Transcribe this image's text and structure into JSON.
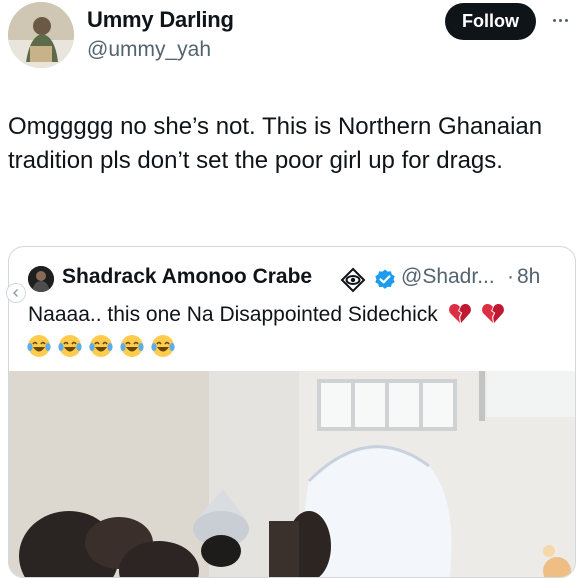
{
  "author": {
    "name": "Ummy Darling",
    "handle": "@ummy_yah",
    "follow_label": "Follow",
    "more_icon": "more-horizontal-icon"
  },
  "tweet": {
    "text": "Omggggg no she’s not. This is Northern Ghanaian tradition pls don’t set the poor girl up for drags."
  },
  "quote": {
    "author_name": "Shadrack Amonoo Crabe",
    "handle": "@Shadr...",
    "separator": "·",
    "time": "8h",
    "text": "Naaaa.. this one Na Disappointed Sidechick",
    "trailing_emoji": [
      "broken-heart",
      "broken-heart"
    ],
    "emoji_row": [
      "face-with-tears-of-joy",
      "face-with-tears-of-joy",
      "face-with-tears-of-joy",
      "face-with-tears-of-joy",
      "face-with-tears-of-joy"
    ],
    "verified_color": "#1d9bf0"
  }
}
